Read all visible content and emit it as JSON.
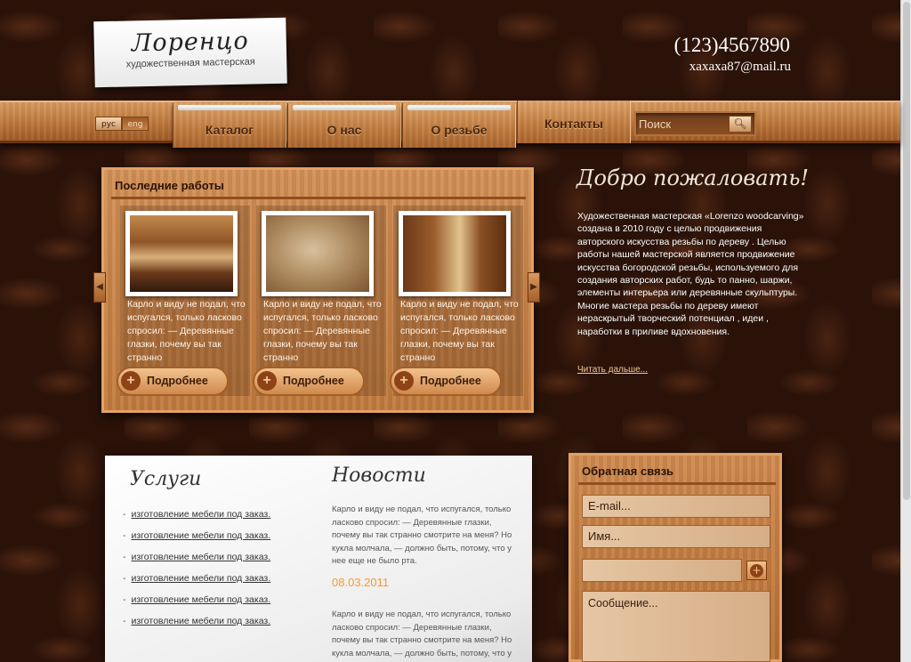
{
  "header": {
    "logo_script": "Лоренцо",
    "logo_subtitle": "художественная мастерская",
    "phone": "(123)4567890",
    "email": "xaxaxa87@mail.ru"
  },
  "lang": {
    "ru": "рус",
    "en": "eng"
  },
  "nav": {
    "items": [
      "Каталог",
      "О нас",
      "О резьбе",
      "Контакты"
    ],
    "search_placeholder": "Поиск"
  },
  "works": {
    "title": "Последние работы",
    "cards": [
      {
        "text": "Карло и виду не подал, что испугался, только ласково спросил: — Деревянные глазки, почему вы так странно",
        "button": "Подробнее"
      },
      {
        "text": "Карло и виду не подал, что испугался, только ласково спросил: — Деревянные глазки, почему вы так странно",
        "button": "Подробнее"
      },
      {
        "text": "Карло и виду не подал, что испугался, только ласково спросил: — Деревянные глазки, почему вы так странно",
        "button": "Подробнее"
      }
    ]
  },
  "welcome": {
    "title": "Добро пожаловать!",
    "text": "Художественная мастерская «Lorenzo woodcarving» создана в 2010 году с целью продвижения авторского искусства резьбы по дереву . Целью работы нашей мастерской является продвижение искусства богородской резьбы, используемого для создания авторских работ, будь то панно, шаржи, элементы интерьера или деревянные скульптуры. Многие мастера резьбы по дереву имеют нераскрытый творческий потенциал , идеи , наработки в приливе вдохновения.",
    "read_more": "Читать дальше..."
  },
  "services": {
    "title": "Услуги",
    "items": [
      "изготовление мебели под заказ.",
      "изготовление мебели под заказ.",
      "изготовление мебели под заказ.",
      "изготовление мебели под заказ.",
      "изготовление мебели под заказ.",
      "изготовление мебели под заказ."
    ]
  },
  "news": {
    "title": "Новости",
    "items": [
      {
        "text": "Карло и виду не подал, что испугался, только ласково спросил: — Деревянные глазки, почему вы так странно смотрите на меня? Но кукла молчала, — должно быть, потому, что у нее еще не было рта.",
        "date": "08.03.2011"
      },
      {
        "text": "Карло и виду не подал, что испугался, только ласково спросил: — Деревянные глазки, почему вы так странно смотрите на меня? Но кукла молчала, — должно быть, потому, что у нее еще не было рта.",
        "date": ""
      }
    ]
  },
  "feedback": {
    "title": "Обратная связь",
    "email_placeholder": "E-mail...",
    "name_placeholder": "Имя...",
    "captcha_value": "",
    "message_placeholder": "Сообщение..."
  },
  "colors": {
    "accent_date": "#f29a33",
    "wood": "#c17a3d",
    "background": "#2a1209"
  },
  "icons": {
    "search": "search-icon",
    "more": "plus-icon",
    "left": "arrow-left-icon",
    "right": "arrow-right-icon"
  }
}
